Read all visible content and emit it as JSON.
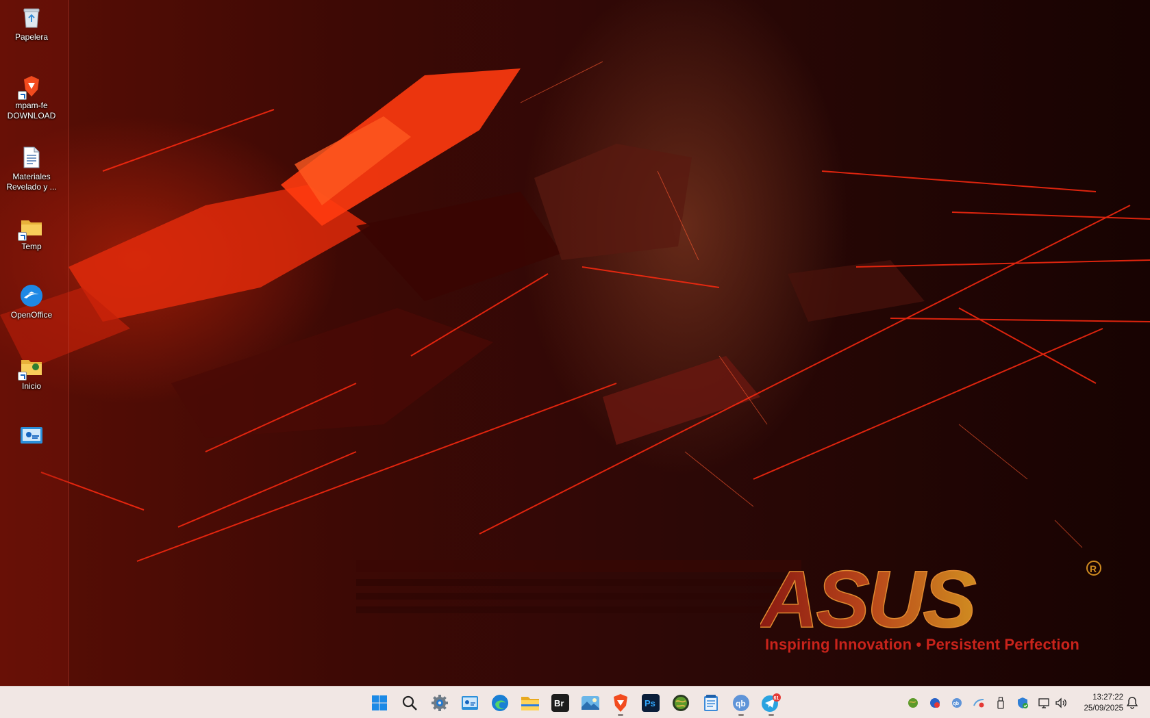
{
  "desktop_icons": [
    {
      "label": "Papelera",
      "icon": "recycle-bin-icon"
    },
    {
      "label": "mpam-fe DOWNLOAD",
      "icon": "brave-shortcut-icon"
    },
    {
      "label": "Materiales Revelado y ...",
      "icon": "document-icon"
    },
    {
      "label": "Temp",
      "icon": "folder-shortcut-icon"
    },
    {
      "label": "OpenOffice",
      "icon": "openoffice-icon"
    },
    {
      "label": "Inicio",
      "icon": "folder-shortcut-icon"
    },
    {
      "label": "",
      "icon": "control-panel-icon"
    }
  ],
  "wallpaper": {
    "brand": "ASUS",
    "registered_mark": "R",
    "tagline": "Inspiring Innovation • Persistent Perfection"
  },
  "taskbar": {
    "apps": [
      {
        "name": "start",
        "icon": "windows-start-icon"
      },
      {
        "name": "search",
        "icon": "search-icon"
      },
      {
        "name": "settings",
        "icon": "settings-gear-icon"
      },
      {
        "name": "control-panel",
        "icon": "control-panel-icon"
      },
      {
        "name": "edge",
        "icon": "edge-browser-icon"
      },
      {
        "name": "file-explorer",
        "icon": "file-explorer-icon"
      },
      {
        "name": "bridge",
        "icon": "adobe-bridge-icon",
        "text": "Br"
      },
      {
        "name": "photos",
        "icon": "photos-app-icon"
      },
      {
        "name": "brave",
        "icon": "brave-browser-icon"
      },
      {
        "name": "photoshop",
        "icon": "adobe-photoshop-icon",
        "text": "Ps"
      },
      {
        "name": "globe-app",
        "icon": "globe-app-icon"
      },
      {
        "name": "notepad",
        "icon": "notepad-icon"
      },
      {
        "name": "qbittorrent",
        "icon": "qbittorrent-icon",
        "text": "qb"
      },
      {
        "name": "telegram",
        "icon": "telegram-icon",
        "badge": "61"
      }
    ],
    "tray": {
      "icons": [
        "globe-tray-icon",
        "antivirus-tray-icon",
        "qbittorrent-tray-icon",
        "network-app-tray-icon",
        "usb-drive-icon",
        "security-shield-icon",
        "network-icon",
        "volume-icon"
      ],
      "time": "13:27:22",
      "date": "25/09/2025"
    }
  },
  "colors": {
    "taskbar_bg": "#f1e7e4",
    "tagline": "#c8231b",
    "brand_gradient_start": "#8a1a12",
    "brand_gradient_end": "#d08c20"
  }
}
